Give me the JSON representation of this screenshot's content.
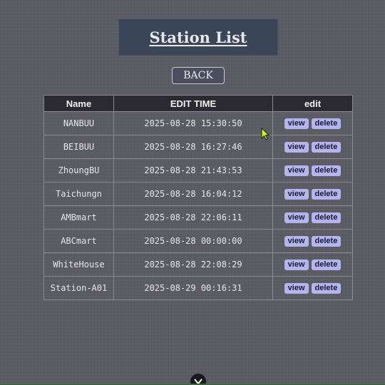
{
  "header": {
    "title": "Station List"
  },
  "back_button": {
    "label": "BACK"
  },
  "table": {
    "columns": [
      "Name",
      "EDIT TIME",
      "edit"
    ],
    "rows": [
      {
        "name": "NANBUU",
        "edit_time": "2025-08-28 15:30:50",
        "view": "view",
        "delete": "delete"
      },
      {
        "name": "BEIBUU",
        "edit_time": "2025-08-28 16:27:46",
        "view": "view",
        "delete": "delete"
      },
      {
        "name": "ZhoungBU",
        "edit_time": "2025-08-28 21:43:53",
        "view": "view",
        "delete": "delete"
      },
      {
        "name": "Taichungn",
        "edit_time": "2025-08-28 16:04:12",
        "view": "view",
        "delete": "delete"
      },
      {
        "name": "AMBmart",
        "edit_time": "2025-08-28 22:06:11",
        "view": "view",
        "delete": "delete"
      },
      {
        "name": "ABCmart",
        "edit_time": "2025-08-28 00:00:00",
        "view": "view",
        "delete": "delete"
      },
      {
        "name": "WhiteHouse",
        "edit_time": "2025-08-28 22:08:29",
        "view": "view",
        "delete": "delete"
      },
      {
        "name": "Station-A01",
        "edit_time": "2025-08-29 00:16:31",
        "view": "view",
        "delete": "delete"
      }
    ]
  },
  "icons": {
    "cursor": "mouse-pointer-icon",
    "scroll": "chevron-down-icon"
  },
  "colors": {
    "background": "#5a5a62",
    "title_box": "#3b4558",
    "table_header": "#2a2a30",
    "action_button": "#b4b4f0",
    "cursor": "#ccff00"
  }
}
